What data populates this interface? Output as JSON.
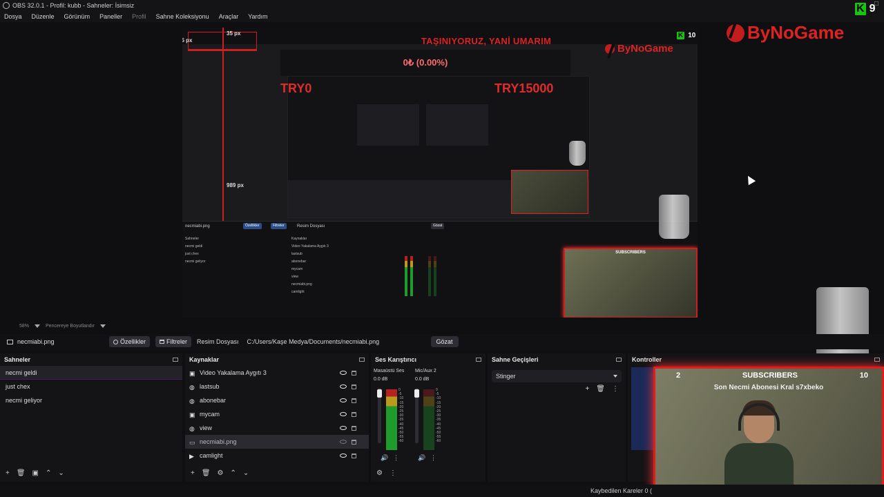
{
  "window": {
    "title": "OBS 32.0.1 - Profil: kubb - Sahneler: İsimsiz"
  },
  "menu": [
    "Dosya",
    "Düzenle",
    "Görünüm",
    "Paneller",
    "Profil",
    "Sahne Koleksiyonu",
    "Araçlar",
    "Yardım"
  ],
  "preview": {
    "banner": "TAŞINIYORUZ, YANİ UMARIM",
    "money": "0₺ (0.00%)",
    "try_left": "TRY0",
    "try_right": "TRY15000",
    "px_top": "35 px",
    "px_left": "35 px",
    "px_mid": "989 px",
    "logo_text": "ByNoGame",
    "kick_count": "10",
    "mini_subs": "SUBSCRIBERS"
  },
  "overlay": {
    "logo_text": "ByNoGame",
    "kick_count": "9",
    "subs_left": "2",
    "subs_label": "SUBSCRIBERS",
    "subs_right": "10",
    "subs_line": "Son Necmi Abonesi Kral s7xbeko"
  },
  "zoom": {
    "level": "58%",
    "label": "Pencereye Boyutlandır"
  },
  "sourcebar": {
    "source_name": "necmiabi.png",
    "properties": "Özellikler",
    "filters": "Filtreler",
    "file_label": "Resim Dosyası",
    "file_path": "C:/Users/Kaşe Medya/Documents/necmiabi.png",
    "browse": "Gözat"
  },
  "scenes": {
    "title": "Sahneler",
    "items": [
      "necmi geldi",
      "just chex",
      "necmi geliyor"
    ]
  },
  "sources": {
    "title": "Kaynaklar",
    "items": [
      {
        "label": "Video Yakalama Aygıtı 3",
        "icon": "camera-icon"
      },
      {
        "label": "lastsub",
        "icon": "globe-icon"
      },
      {
        "label": "abonebar",
        "icon": "globe-icon"
      },
      {
        "label": "mycam",
        "icon": "camera-icon"
      },
      {
        "label": "view",
        "icon": "globe-icon"
      },
      {
        "label": "necmiabi.png",
        "icon": "image-icon"
      },
      {
        "label": "camlight",
        "icon": "play-icon"
      }
    ]
  },
  "mixer": {
    "title": "Ses Karıştırıcı",
    "channels": [
      {
        "name": "Masaüstü Ses",
        "db": "0.0 dB"
      },
      {
        "name": "Mic/Aux 2",
        "db": "0.0 dB"
      }
    ],
    "scale": [
      "0",
      "-5",
      "-10",
      "-15",
      "-20",
      "-25",
      "-30",
      "-35",
      "-40",
      "-45",
      "-50",
      "-55",
      "-60"
    ]
  },
  "transitions": {
    "title": "Sahne Geçişleri",
    "selected": "Stinger"
  },
  "controls": {
    "title": "Kontroller"
  },
  "status": {
    "dropped": "Kaybedilen Kareler 0 ("
  },
  "colors": {
    "accent_red": "#e51b1b",
    "kick_green": "#16c60c",
    "button_blue": "#2b4d88"
  }
}
